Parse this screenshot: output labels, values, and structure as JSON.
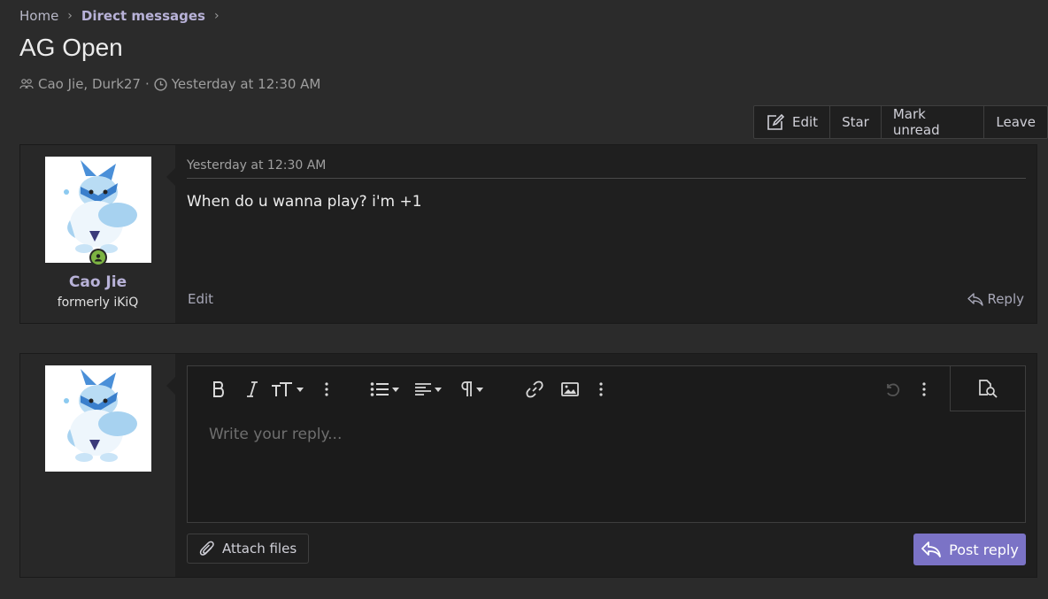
{
  "breadcrumb": {
    "home": "Home",
    "section": "Direct messages"
  },
  "title": "AG Open",
  "meta": {
    "participants": "Cao Jie, Durk27",
    "separator": "·",
    "time": "Yesterday at 12:30 AM"
  },
  "actions": {
    "edit": "Edit",
    "star": "Star",
    "mark_unread": "Mark unread",
    "leave": "Leave"
  },
  "message": {
    "username": "Cao Jie",
    "user_title": "formerly iKiQ",
    "date": "Yesterday at 12:30 AM",
    "body": "When do u wanna play? i'm +1",
    "edit_label": "Edit",
    "reply_label": "Reply"
  },
  "reply_form": {
    "placeholder": "Write your reply...",
    "attach_label": "Attach files",
    "post_label": "Post reply"
  },
  "toolbar_icons": [
    "bold-icon",
    "italic-icon",
    "text-size-icon",
    "more-icon",
    "list-icon",
    "align-icon",
    "paragraph-icon",
    "link-icon",
    "image-icon",
    "more-icon",
    "undo-icon",
    "more-icon",
    "preview-icon"
  ],
  "colors": {
    "accent": "#7b73c6",
    "online": "#7cb342",
    "username": "#b8b2d8"
  }
}
